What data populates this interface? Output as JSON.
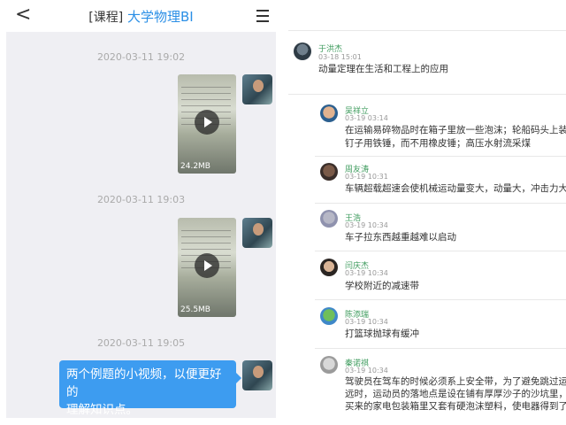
{
  "left_panel": {
    "header": {
      "back": "<",
      "course_tag": "[课程]",
      "course_name": "大学物理BI"
    },
    "messages": [
      {
        "time": "2020-03-11 19:02",
        "size": "24.2MB"
      },
      {
        "time": "2020-03-11 19:03",
        "size": "25.5MB"
      },
      {
        "time": "2020-03-11 19:05",
        "text_line1": "两个例题的小视频，以便更好的",
        "text_line2": "理解知识点。"
      }
    ]
  },
  "right_panel": {
    "post": {
      "user": "于洪杰",
      "date": "03-18 15:01",
      "text": "动量定理在生活和工程上的应用"
    },
    "replies": [
      {
        "user": "吴祥立",
        "date": "03-19 03:14",
        "line1": "在运输易碎物品时在箱子里放一些泡沫；轮船码头上装有橡皮轮胎；",
        "line2": "钉子用铁锤，而不用橡皮锤；高压水射流采煤"
      },
      {
        "user": "周友涛",
        "date": "03-19 10:31",
        "line1": "车辆超载超速会使机械运动量变大，动量大，冲击力大，不安全！"
      },
      {
        "user": "王浩",
        "date": "03-19 10:34",
        "line1": "车子拉东西越重越难以启动"
      },
      {
        "user": "闫庆杰",
        "date": "03-19 10:34",
        "line1": "学校附近的减速带"
      },
      {
        "user": "陈添瑞",
        "date": "03-19 10:34",
        "line1": "打篮球抛球有缓冲"
      },
      {
        "user": "秦诺祺",
        "date": "03-19 10:34",
        "line1": "驾驶员在驾车的时候必须系上安全带，为了避免跳过运动员倒地时",
        "line2": "远时，运动员的落地点是设在铺有厚厚沙子的沙坑里，装在瓦楞纸",
        "line3": "买来的家电包装箱里又套有硬泡沫塑料，使电器得到了保护"
      }
    ]
  }
}
